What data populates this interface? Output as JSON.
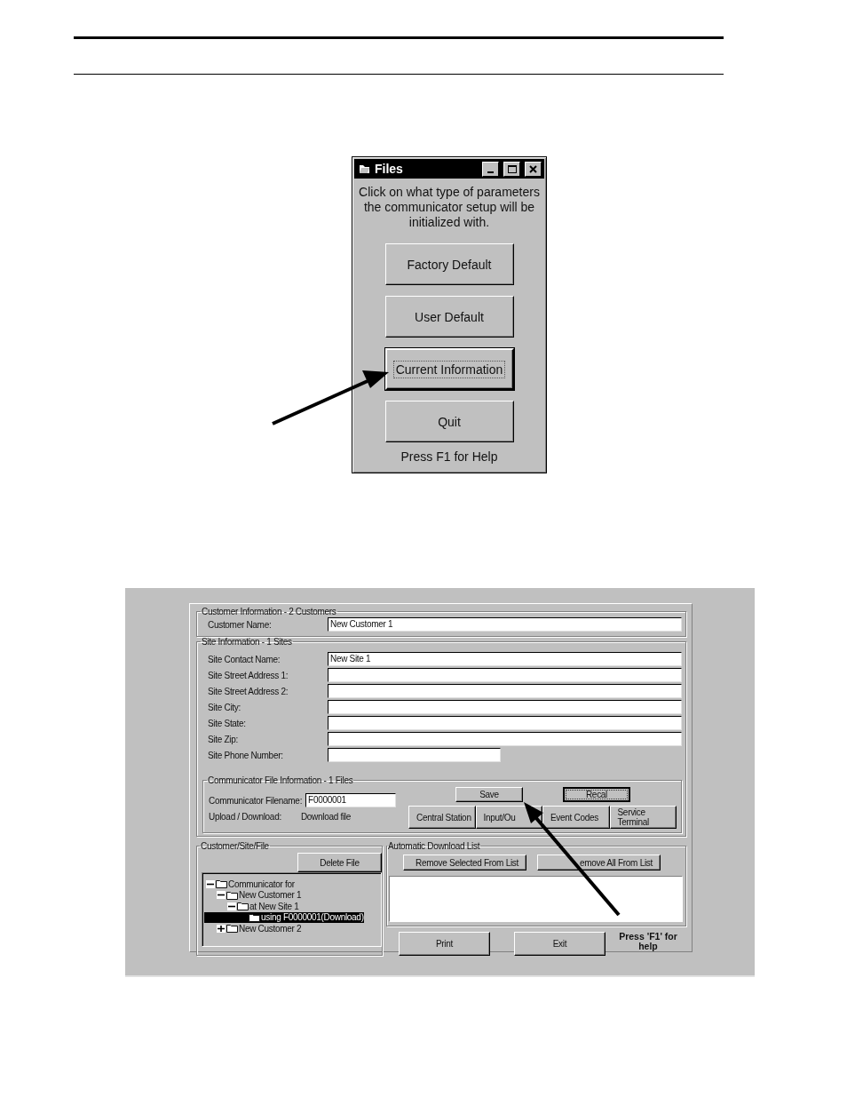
{
  "files_dialog": {
    "title": "Files",
    "message": "Click on what type of parameters the communicator setup will be initialized with.",
    "buttons": [
      {
        "label": "Factory Default",
        "focused": false
      },
      {
        "label": "User Default",
        "focused": false
      },
      {
        "label": "Current Information",
        "focused": true
      },
      {
        "label": "Quit",
        "focused": false
      }
    ],
    "help": "Press F1 for Help"
  },
  "setup_form": {
    "customer_info": {
      "title": "Customer Information - 2 Customers",
      "fields": [
        {
          "label": "Customer Name:",
          "value": "New Customer 1",
          "kind": "full"
        }
      ]
    },
    "site_info": {
      "title": "Site Information - 1 Sites",
      "fields": [
        {
          "label": "Site Contact Name:",
          "value": "New Site 1",
          "kind": "full"
        },
        {
          "label": "Site Street Address 1:",
          "kind": "full"
        },
        {
          "label": "Site Street Address 2:",
          "kind": "full"
        },
        {
          "label": "Site City:",
          "kind": "full"
        },
        {
          "label": "Site State:",
          "kind": "full"
        },
        {
          "label": "Site Zip:",
          "kind": "full"
        },
        {
          "label": "Site Phone Number:",
          "kind": "short"
        }
      ]
    },
    "file_info": {
      "title": "Communicator File Information - 1 Files",
      "filename_label": "Communicator Filename:",
      "filename": "F0000001",
      "mode_label": "Upload / Download:",
      "mode": "Download file",
      "actions": [
        {
          "label": "Save",
          "focused": false
        },
        {
          "label": "Recal",
          "focused": true
        }
      ],
      "sections": [
        "Central Station",
        "Input/Ou",
        "Event Codes",
        "Service Terminal"
      ]
    },
    "tree_panel": {
      "title": "Customer/Site/File",
      "delete_button": "Delete File",
      "tree": [
        {
          "label": "Communicator for",
          "expanded": true,
          "selected": false,
          "children": [
            {
              "label": "New Customer 1",
              "expanded": true,
              "selected": false,
              "children": [
                {
                  "label": "at New Site 1",
                  "expanded": true,
                  "selected": false,
                  "children": [
                    {
                      "label": "using F0000001(Download)",
                      "selected": true
                    }
                  ]
                }
              ]
            },
            {
              "label": "New Customer 2",
              "expanded": false,
              "selected": false
            }
          ]
        }
      ]
    },
    "download_list": {
      "title": "Automatic Download List",
      "buttons": [
        "Remove Selected From List",
        "emove All From List"
      ]
    },
    "buttons": [
      "Print",
      "Exit"
    ],
    "help": "Press 'F1' for help"
  }
}
